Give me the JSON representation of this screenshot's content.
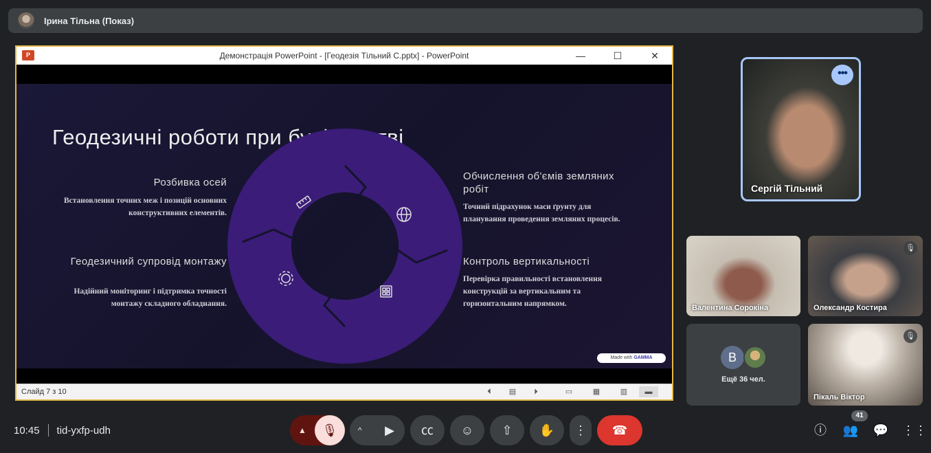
{
  "presenter": {
    "name": "Ірина Тільна (Показ)"
  },
  "powerpoint": {
    "window_title": "Демонстрація PowerPoint - [Геодезія Тільний С.pptx] - PowerPoint",
    "logo": "P",
    "slide": {
      "title": "Геодезичні роботи при будівництві",
      "sections": [
        {
          "heading": "Розбивка осей",
          "body": "Встановлення точних меж і позицій основних конструктивних елементів.",
          "icon": "ruler-icon"
        },
        {
          "heading": "Обчислення об'ємів земляних робіт",
          "body": "Точний підрахунок маси ґрунту для планування проведення земляних процесів.",
          "icon": "globe-icon"
        },
        {
          "heading": "Геодезичний супровід монтажу",
          "body": "Надійний моніторинг і підтримка точності монтажу складного обладнання.",
          "icon": "gear-icon"
        },
        {
          "heading": "Контроль вертикальності",
          "body": "Перевірка правильності встановлення конструкцій за вертикальним та горизонтальним напрямком.",
          "icon": "grid-icon"
        }
      ],
      "badge_prefix": "Made with",
      "badge_brand": "GAMMA"
    },
    "status": {
      "slide_counter": "Слайд 7 з 10"
    }
  },
  "participants": {
    "featured": {
      "name": "Сергій Тільний"
    },
    "tiles": [
      {
        "name": "Валентина Сорокіна"
      },
      {
        "name": "Олександр Костира"
      },
      {
        "name": "Пікаль Віктор"
      }
    ],
    "others": {
      "avatar_letter": "В",
      "label": "Ещё 36 чел."
    }
  },
  "meeting": {
    "time": "10:45",
    "code": "tid-yxfp-udh",
    "participant_count": "41"
  },
  "colors": {
    "accent": "#a8c7fa",
    "end_call": "#dc362e",
    "mic_off_bg": "#f9dedc",
    "share_border": "#e5b94a",
    "ring": "#3d1d7a"
  }
}
